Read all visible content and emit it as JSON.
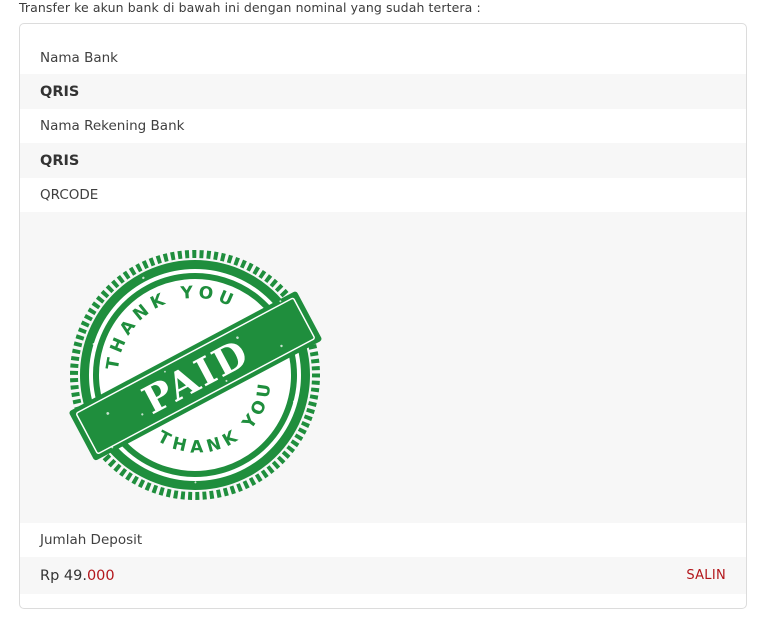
{
  "intro_text": "Transfer ke akun bank di bawah ini dengan nominal yang sudah tertera :",
  "bank_name_label": "Nama Bank",
  "bank_name_value": "QRIS",
  "account_name_label": "Nama Rekening Bank",
  "account_name_value": "QRIS",
  "qrcode_label": "QRCODE",
  "stamp": {
    "top_text": "THANK YOU",
    "center_text": "PAID",
    "bottom_text": "THANK YOU",
    "color": "#1f8e3d"
  },
  "deposit_label": "Jumlah Deposit",
  "deposit_amount_main": "Rp 49.",
  "deposit_amount_tail": "000",
  "copy_button_label": "SALIN",
  "accent_color": "#b3161b"
}
